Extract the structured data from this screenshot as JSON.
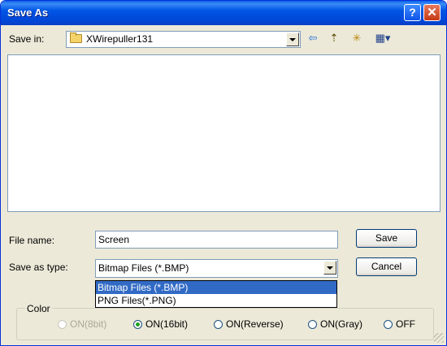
{
  "window": {
    "title": "Save As"
  },
  "titlebar": {
    "help_glyph": "?",
    "close_glyph": "✕"
  },
  "save_in": {
    "label": "Save in:",
    "folder": "XWirepuller131"
  },
  "toolbar": {
    "back_glyph": "⇦",
    "up_glyph": "⇡",
    "new_folder_glyph": "✳",
    "view_glyph": "▦▾",
    "icons": [
      "back-icon",
      "up-folder-icon",
      "new-folder-icon",
      "view-menu-icon"
    ]
  },
  "file_name": {
    "label": "File name:",
    "value": "Screen"
  },
  "save_type": {
    "label": "Save as type:",
    "value": "Bitmap Files (*.BMP)",
    "options": [
      "Bitmap Files (*.BMP)",
      "PNG Files(*.PNG)"
    ]
  },
  "buttons": {
    "save": "Save",
    "cancel": "Cancel"
  },
  "color_group": {
    "legend": "Color",
    "options": [
      {
        "label": "ON(8bit)",
        "checked": false,
        "disabled": true
      },
      {
        "label": "ON(16bit)",
        "checked": true,
        "disabled": false
      },
      {
        "label": "ON(Reverse)",
        "checked": false,
        "disabled": false
      },
      {
        "label": "ON(Gray)",
        "checked": false,
        "disabled": false
      },
      {
        "label": "OFF",
        "checked": false,
        "disabled": false
      }
    ]
  },
  "colors": {
    "titlebar": "#0054E3",
    "selection": "#316AC5",
    "dialog_bg": "#ECE9D8"
  }
}
